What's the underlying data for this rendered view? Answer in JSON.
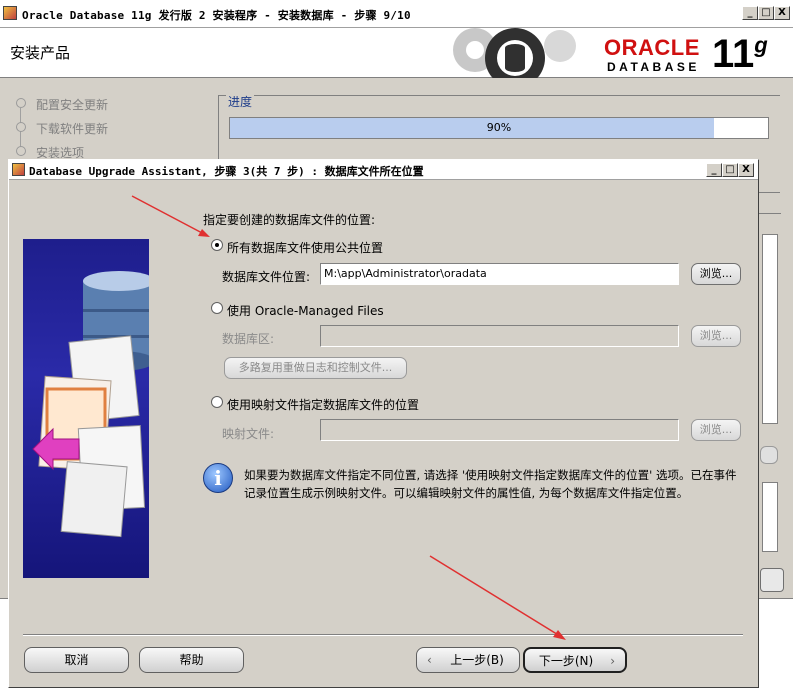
{
  "outer_window": {
    "title": "Oracle Database 11g 发行版 2 安装程序 - 安装数据库 - 步骤 9/10",
    "page_title": "安装产品",
    "logo_oracle": "ORACLE",
    "logo_database": "DATABASE",
    "logo_version": "11",
    "logo_version_g": "g",
    "steps": [
      "配置安全更新",
      "下载软件更新",
      "安装选项"
    ],
    "progress_label": "进度",
    "progress_text": "90%",
    "progress_value": 0.9
  },
  "dialog": {
    "title": "Database Upgrade Assistant, 步骤 3(共 7 步) : 数据库文件所在位置",
    "heading": "指定要创建的数据库文件的位置:",
    "option1_label": "所有数据库文件使用公共位置",
    "option1_field_label": "数据库文件位置:",
    "option1_field_value": "M:\\app\\Administrator\\oradata",
    "browse_label": "浏览...",
    "option2_label": "使用 Oracle-Managed Files",
    "option2_field_label": "数据库区:",
    "multiplex_button": "多路复用重做日志和控制文件...",
    "option3_label": "使用映射文件指定数据库文件的位置",
    "option3_field_label": "映射文件:",
    "info_text": "如果要为数据库文件指定不同位置, 请选择 '使用映射文件指定数据库文件的位置' 选项。已在事件记录位置生成示例映射文件。可以编辑映射文件的属性值, 为每个数据库文件指定位置。",
    "cancel_button": "取消",
    "help_button": "帮助",
    "back_button": "上一步(B)",
    "next_button": "下一步(N)",
    "window_buttons": [
      "_",
      "□",
      "X"
    ]
  }
}
